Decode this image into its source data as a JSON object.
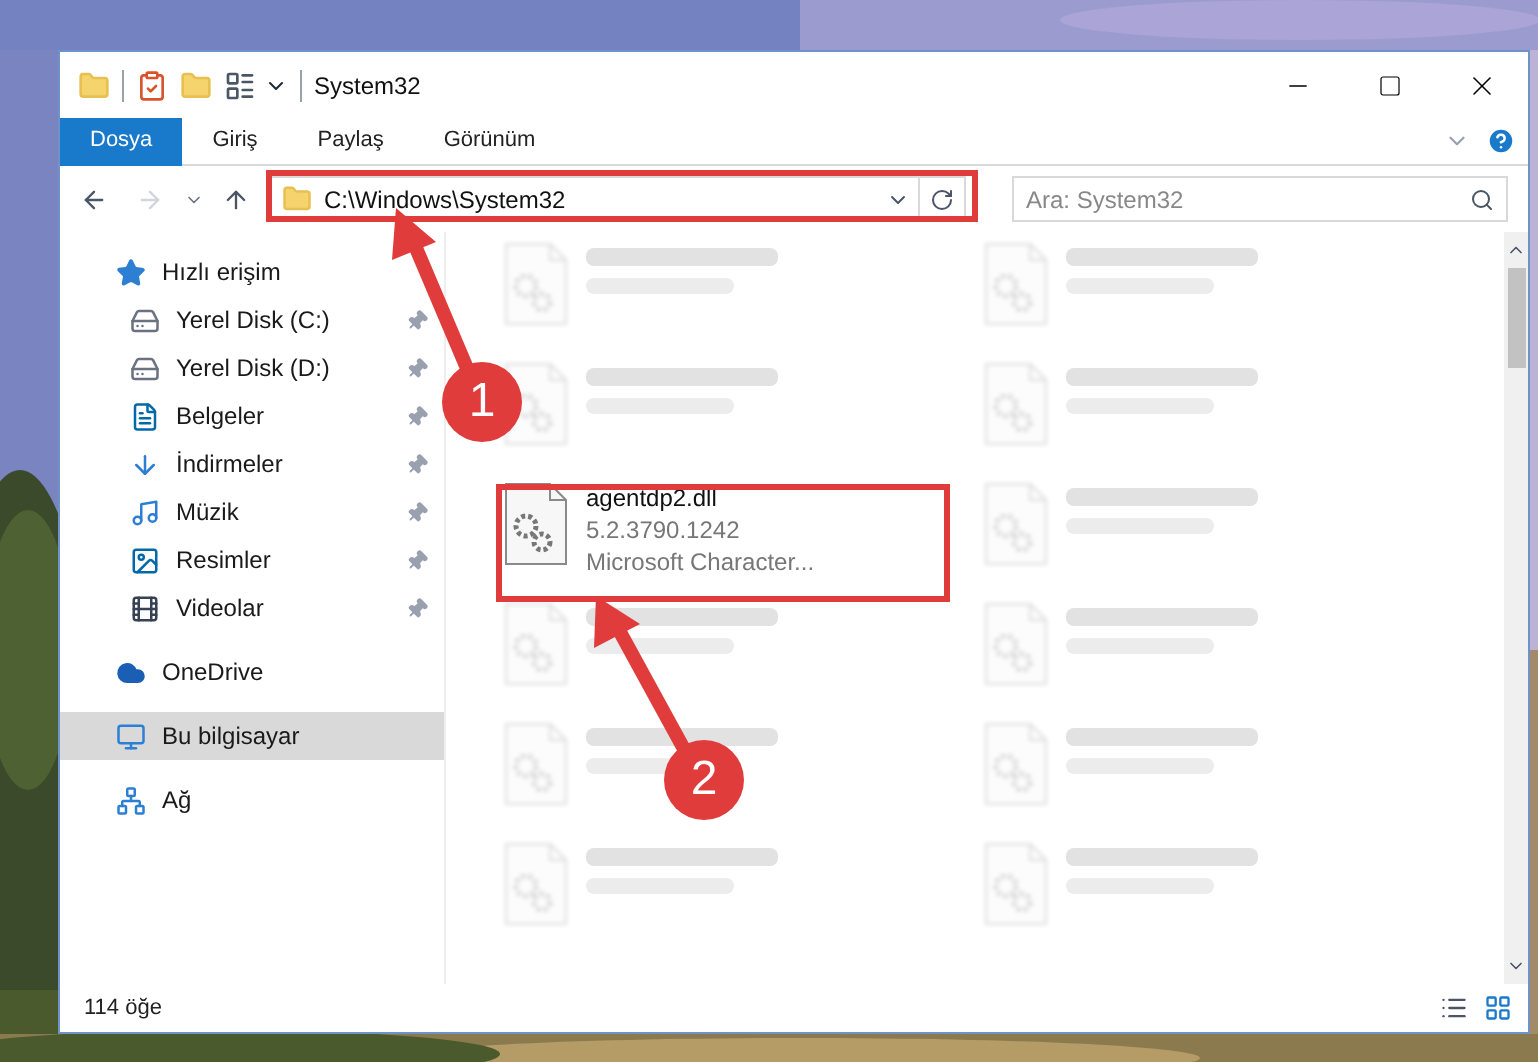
{
  "window": {
    "title": "System32"
  },
  "ribbon_tabs": [
    {
      "label": "Dosya",
      "selected": true
    },
    {
      "label": "Giriş",
      "selected": false
    },
    {
      "label": "Paylaş",
      "selected": false
    },
    {
      "label": "Görünüm",
      "selected": false
    }
  ],
  "address": {
    "path": "C:\\Windows\\System32"
  },
  "search": {
    "placeholder": "Ara: System32"
  },
  "sidebar": {
    "items": [
      {
        "label": "Hızlı erişim",
        "selected": false,
        "children": [
          {
            "label": "Yerel Disk (C:)",
            "selected": false,
            "pinned": true
          },
          {
            "label": "Yerel Disk (D:)",
            "selected": false,
            "pinned": true
          },
          {
            "label": "Belgeler",
            "selected": false,
            "pinned": true
          },
          {
            "label": "İndirmeler",
            "selected": false,
            "pinned": true
          },
          {
            "label": "Müzik",
            "selected": false,
            "pinned": true
          },
          {
            "label": "Resimler",
            "selected": false,
            "pinned": true
          },
          {
            "label": "Videolar",
            "selected": false,
            "pinned": true
          }
        ]
      },
      {
        "label": "OneDrive",
        "selected": false
      },
      {
        "label": "Bu bilgisayar",
        "selected": true
      },
      {
        "label": "Ağ",
        "selected": false
      }
    ]
  },
  "files": [
    {
      "kind": "blurred"
    },
    {
      "kind": "blurred"
    },
    {
      "kind": "blurred"
    },
    {
      "kind": "blurred"
    },
    {
      "kind": "focused",
      "name": "agentdp2.dll",
      "version": "5.2.3790.1242",
      "description": "Microsoft Character..."
    },
    {
      "kind": "blurred"
    },
    {
      "kind": "blurred"
    },
    {
      "kind": "blurred"
    },
    {
      "kind": "blurred"
    },
    {
      "kind": "blurred"
    },
    {
      "kind": "blurred"
    },
    {
      "kind": "blurred"
    }
  ],
  "status_bar": {
    "count": "114 öğe"
  },
  "annotations": [
    {
      "label": "1"
    },
    {
      "label": "2"
    }
  ]
}
